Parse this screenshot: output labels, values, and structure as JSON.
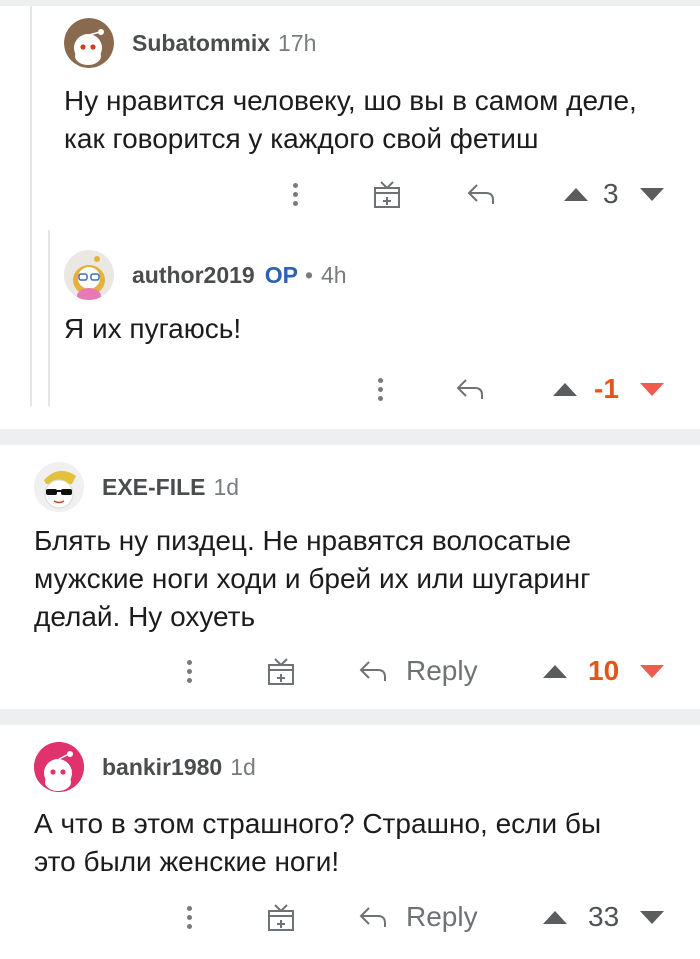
{
  "comments": [
    {
      "username": "Subatommix",
      "time": "17h",
      "op_badge": "",
      "text_lines": [
        "Ну нравится человеку, шо вы в самом деле,",
        "как говорится у каждого свой фетиш"
      ],
      "score": "3",
      "reply_label": "",
      "avatar_icon": "snoo-brown-avatar-icon"
    },
    {
      "username": "author2019",
      "op_badge": "OP",
      "separator": "•",
      "time": "4h",
      "text_lines": [
        "Я их пугаюсь!"
      ],
      "score": "-1",
      "reply_label": "",
      "avatar_icon": "snoo-girl-avatar-icon"
    },
    {
      "username": "EXE-FILE",
      "time": "1d",
      "op_badge": "",
      "text_lines": [
        "Блять ну пиздец. Не нравятся волосатые",
        "мужские ноги ходи и брей их или шугаринг",
        "делай. Ну охуеть"
      ],
      "score": "10",
      "reply_label": "Reply",
      "avatar_icon": "snoo-sunglasses-avatar-icon"
    },
    {
      "username": "bankir1980",
      "time": "1d",
      "op_badge": "",
      "text_lines": [
        "А что в этом страшного? Страшно, если бы",
        "это были женские ноги!"
      ],
      "score": "33",
      "reply_label": "Reply",
      "avatar_icon": "snoo-pink-avatar-icon"
    }
  ],
  "colors": {
    "accent_orange": "#e3541c",
    "downvote_red": "#f15a4e",
    "op_blue": "#2b62b5",
    "separator_gray": "#edeff1"
  }
}
